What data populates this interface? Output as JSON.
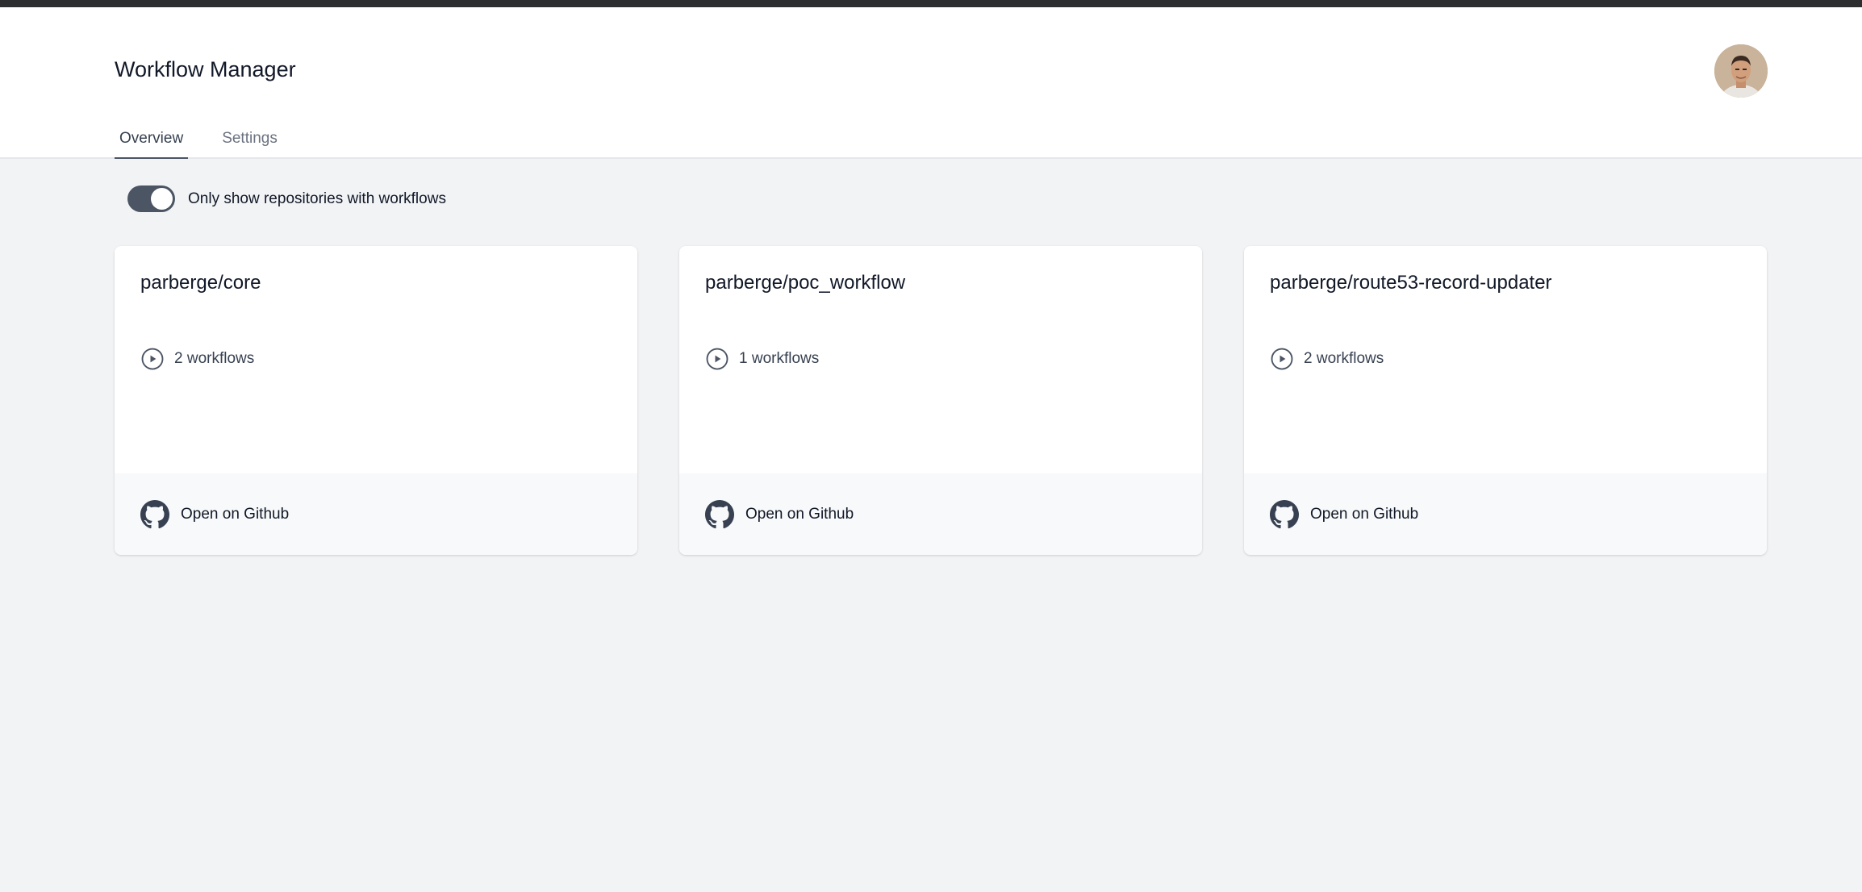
{
  "app": {
    "title": "Workflow Manager"
  },
  "tabs": [
    {
      "label": "Overview",
      "active": true
    },
    {
      "label": "Settings",
      "active": false
    }
  ],
  "filter": {
    "toggle_label": "Only show repositories with workflows",
    "toggle_on": true
  },
  "repos": [
    {
      "name": "parberge/core",
      "workflows": "2 workflows",
      "link_label": "Open on Github"
    },
    {
      "name": "parberge/poc_workflow",
      "workflows": "1 workflows",
      "link_label": "Open on Github"
    },
    {
      "name": "parberge/route53-record-updater",
      "workflows": "2 workflows",
      "link_label": "Open on Github"
    }
  ],
  "icons": {
    "workflow": "play-circle-icon",
    "github": "github-icon"
  },
  "colors": {
    "accent": "#4b5563",
    "background": "#f2f3f5",
    "topbar": "#2d2e30"
  }
}
